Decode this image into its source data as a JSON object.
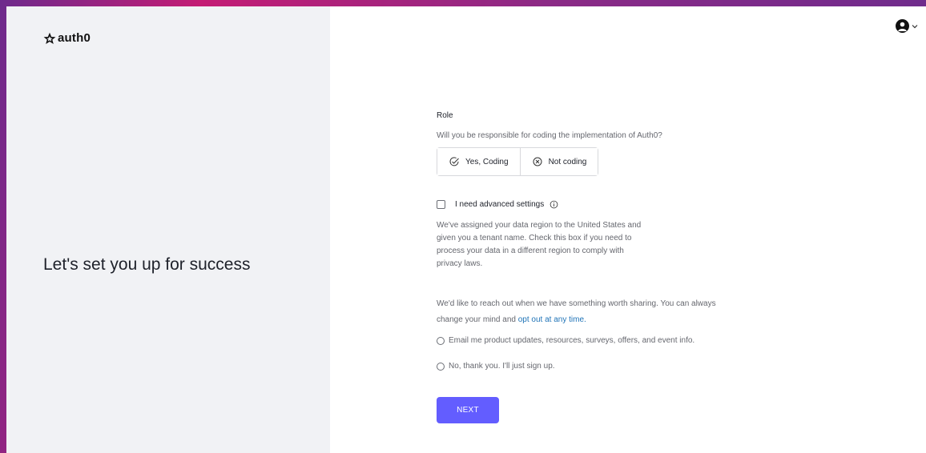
{
  "brand": {
    "name": "auth0"
  },
  "left": {
    "headline": "Let's set you up for success"
  },
  "header": {
    "account_icon": "user-avatar-icon",
    "menu_icon": "chevron-down-icon"
  },
  "role": {
    "label": "Role",
    "question": "Will you be responsible for coding the implementation of Auth0?",
    "options": [
      {
        "label": "Yes, Coding",
        "icon": "check-circle-icon"
      },
      {
        "label": "Not coding",
        "icon": "x-circle-icon"
      }
    ]
  },
  "advanced": {
    "label": "I need advanced settings",
    "description": "We've assigned your data region to the United States and given you a tenant name. Check this box if you need to process your data in a different region to comply with privacy laws."
  },
  "marketing": {
    "intro": "We'd like to reach out when we have something worth sharing. You can always change your mind and",
    "link": "opt out at any time.",
    "options": [
      "Email me product updates, resources, surveys, offers, and event info.",
      "No, thank you. I'll just sign up."
    ]
  },
  "actions": {
    "next_label": "NEXT"
  },
  "colors": {
    "primary": "#635dff",
    "link": "#1f73b7",
    "panel": "#f1f2f5"
  }
}
